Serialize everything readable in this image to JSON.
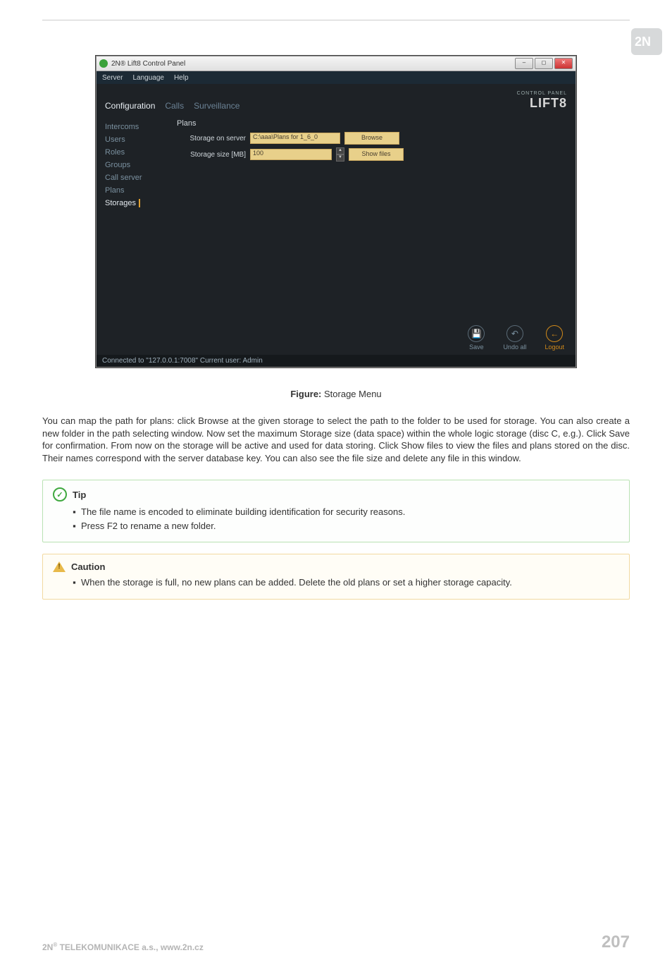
{
  "header": {
    "brand": "2N"
  },
  "screenshot": {
    "window_title": "2N® Lift8 Control Panel",
    "menus": {
      "server": "Server",
      "language": "Language",
      "help": "Help"
    },
    "nav": {
      "configuration": "Configuration",
      "calls": "Calls",
      "surveillance": "Surveillance"
    },
    "product_logo_small": "CONTROL PANEL",
    "product_logo_big": "LIFT8",
    "sidebar": {
      "intercoms": "Intercoms",
      "users": "Users",
      "roles": "Roles",
      "groups": "Groups",
      "callserver": "Call server",
      "plans": "Plans",
      "storages": "Storages"
    },
    "panel": {
      "group": "Plans",
      "row1_label": "Storage on server",
      "row1_value": "C:\\aaa\\Plans for 1_6_0",
      "row1_btn": "Browse",
      "row2_label": "Storage size [MB]",
      "row2_value": "100",
      "row2_btn": "Show files"
    },
    "bottom": {
      "save": "Save",
      "undo": "Undo all",
      "logout": "Logout"
    },
    "status": "Connected to \"127.0.0.1:7008\"  Current user: Admin"
  },
  "caption": {
    "label": "Figure:",
    "text": " Storage Menu"
  },
  "paragraph": "You can map the path for plans: click Browse at the given storage to select the path to the folder to be used for storage. You can also create a new folder in the path selecting window. Now set the maximum Storage size (data space) within the whole logic storage (disc C, e.g.). Click Save for confirmation. From now on the storage will be active and used for data storing. Click Show files to view the files and plans stored on the disc. Their names correspond with the server database key. You can also see the file size and delete any file in this window.",
  "tip": {
    "title": "Tip",
    "items": [
      "The file name is encoded to eliminate building identification for security reasons.",
      "Press F2 to rename a new folder."
    ]
  },
  "caution": {
    "title": "Caution",
    "items": [
      "When the storage is full, no new plans can be added. Delete the old plans or set a higher storage capacity."
    ]
  },
  "footer": {
    "company": "2N® TELEKOMUNIKACE a.s., www.2n.cz",
    "page": "207"
  }
}
